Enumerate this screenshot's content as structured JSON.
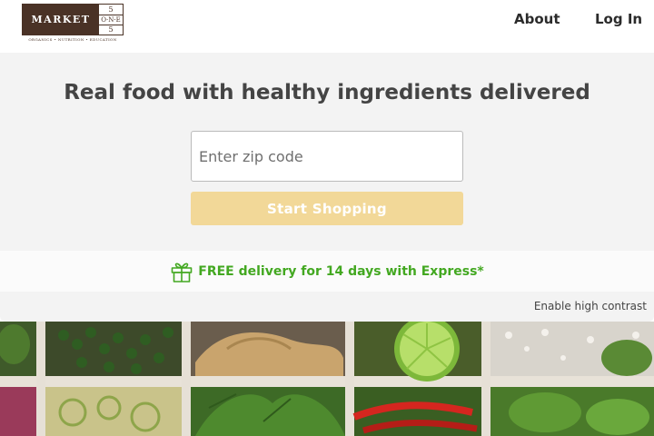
{
  "header": {
    "logo": {
      "word": "MARKET",
      "digits": [
        "5",
        "O·N·E",
        "5"
      ],
      "tagline": "ORGANICS • NUTRITION • EDUCATION"
    },
    "nav": {
      "about": "About",
      "login": "Log In"
    }
  },
  "hero": {
    "headline": "Real food with healthy ingredients delivered",
    "zip_placeholder": "Enter zip code",
    "zip_value": "",
    "start_button": "Start Shopping"
  },
  "promo": {
    "icon": "gift-icon",
    "text": "FREE delivery for 14 days with Express*"
  },
  "accessibility": {
    "contrast_link": "Enable high contrast"
  },
  "colors": {
    "brand_brown": "#4a3226",
    "promo_green": "#43a821",
    "button_yellow": "#f2d898",
    "hero_bg": "#f3f3f3"
  }
}
